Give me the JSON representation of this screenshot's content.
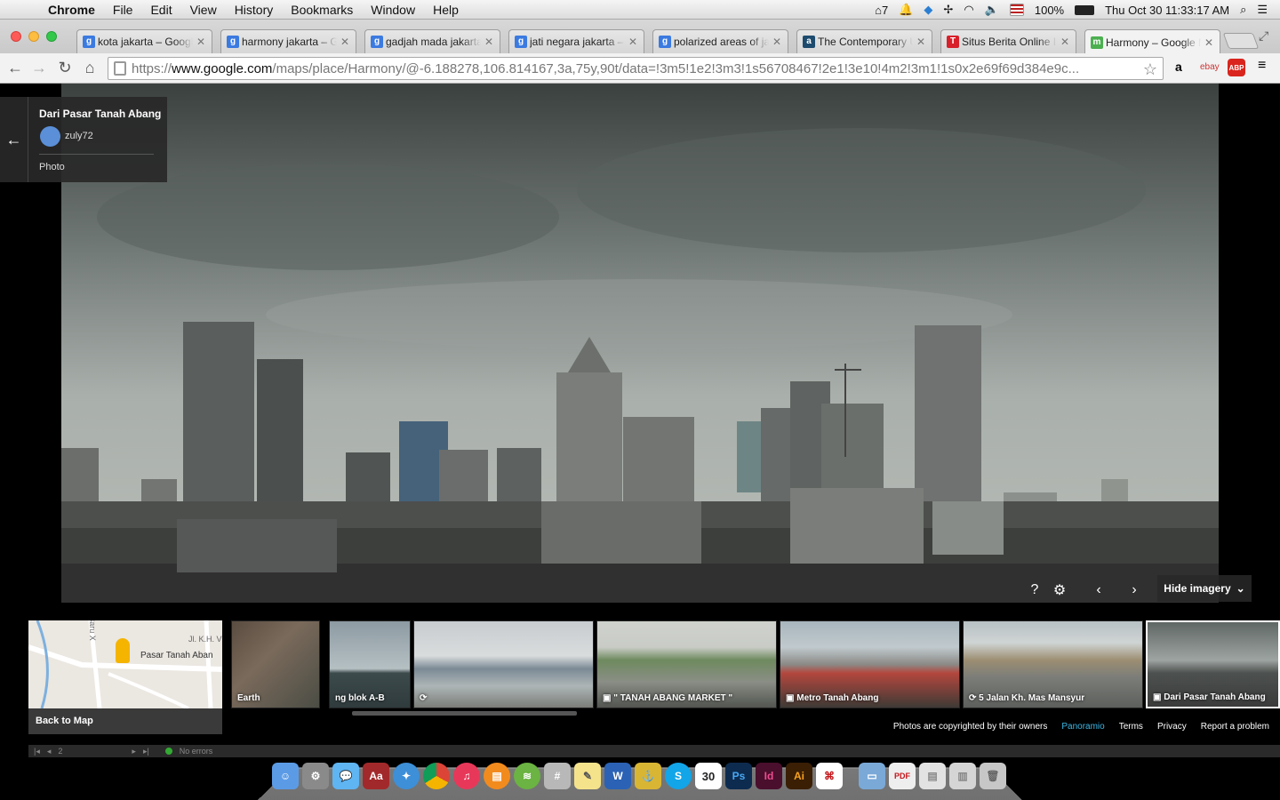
{
  "menubar": {
    "app": "Chrome",
    "items": [
      "File",
      "Edit",
      "View",
      "History",
      "Bookmarks",
      "Window",
      "Help"
    ],
    "status": {
      "adobe_count": "7",
      "battery": "100%",
      "datetime": "Thu Oct 30  11:33:17 AM"
    }
  },
  "tabs": [
    {
      "title": "kota jakarta – Googl",
      "favicon": "g",
      "color": "#3b7ae0"
    },
    {
      "title": "harmony jakarta – G",
      "favicon": "g",
      "color": "#3b7ae0"
    },
    {
      "title": "gadjah mada jakarta",
      "favicon": "g",
      "color": "#3b7ae0"
    },
    {
      "title": "jati negara jakarta –",
      "favicon": "g",
      "color": "#3b7ae0"
    },
    {
      "title": "polarized areas of ja",
      "favicon": "g",
      "color": "#3b7ae0"
    },
    {
      "title": "The Contemporary U",
      "favicon": "a",
      "color": "#1d4b6e"
    },
    {
      "title": "Situs Berita Online In",
      "favicon": "T",
      "color": "#d8202a"
    },
    {
      "title": "Harmony – Google M",
      "favicon": "m",
      "color": "#4caf50"
    }
  ],
  "toolbar": {
    "url_scheme": "https://",
    "url_host": "www.google.com",
    "url_path": "/maps/place/Harmony/@-6.188278,106.814167,3a,75y,90t/data=!3m5!1e2!3m3!1s56708467!2e1!3e10!4m2!3m1!1s0x2e69f69d384e9c..."
  },
  "infocard": {
    "title": "Dari Pasar Tanah Abang",
    "user": "zuly72",
    "type": "Photo"
  },
  "controls": {
    "hide_imagery": "Hide imagery"
  },
  "minimap": {
    "back_label": "Back to Map",
    "place_label": "Pasar Tanah Aban",
    "street1": "Jl. K.H. V",
    "street2": "Baru X"
  },
  "thumbnails": [
    {
      "caption": "Earth",
      "icon": "none"
    },
    {
      "caption": "ng blok A-B",
      "icon": "none"
    },
    {
      "caption": "",
      "icon": "panorama-icon"
    },
    {
      "caption": "\" TANAH ABANG MARKET \"",
      "icon": "camera-icon"
    },
    {
      "caption": "Metro Tanah Abang",
      "icon": "camera-icon"
    },
    {
      "caption": "5 Jalan Kh. Mas Mansyur",
      "icon": "panorama-icon"
    },
    {
      "caption": "Dari Pasar Tanah Abang",
      "icon": "camera-icon"
    }
  ],
  "footer": {
    "copyright": "Photos are copyrighted by their owners",
    "panoramio": "Panoramio",
    "terms": "Terms",
    "privacy": "Privacy",
    "report": "Report a problem"
  },
  "devbar": {
    "page": "2",
    "errors": "No errors"
  }
}
